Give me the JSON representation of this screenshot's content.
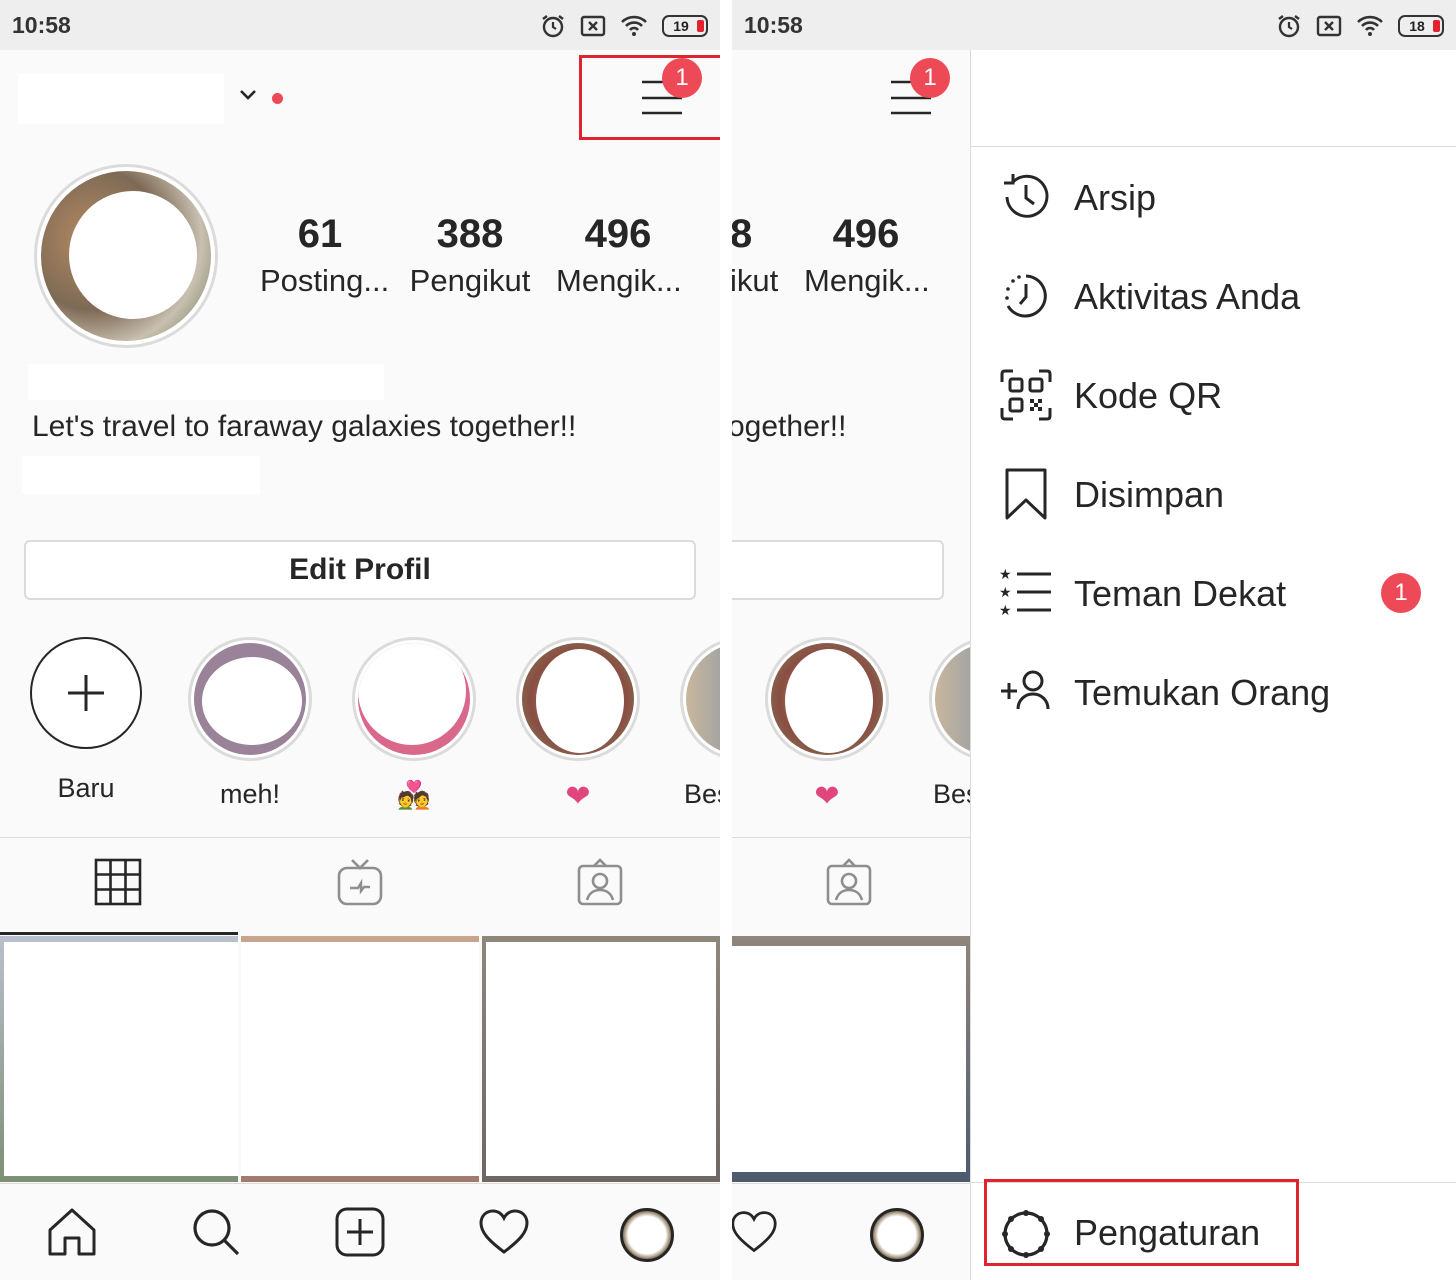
{
  "left_screen": {
    "status": {
      "time": "10:58",
      "battery": "19"
    },
    "header": {
      "menu_badge": "1"
    },
    "stats": [
      {
        "value": "61",
        "label": "Posting..."
      },
      {
        "value": "388",
        "label": "Pengikut"
      },
      {
        "value": "496",
        "label": "Mengik..."
      }
    ],
    "bio": "Let's travel to faraway galaxies together!!",
    "edit_profile_label": "Edit Profil",
    "highlights": [
      {
        "label": "Baru"
      },
      {
        "label": "meh!"
      },
      {
        "label": "💑"
      },
      {
        "label": "❤"
      },
      {
        "label": "Bes"
      }
    ]
  },
  "right_screen": {
    "status": {
      "time": "10:58",
      "battery": "18"
    },
    "header": {
      "menu_badge": "1"
    },
    "stats": [
      {
        "value": "8",
        "label": "ikut"
      },
      {
        "value": "496",
        "label": "Mengik..."
      }
    ],
    "bio": "ogether!!",
    "highlights": [
      {
        "label": "❤"
      },
      {
        "label": "Bes"
      }
    ]
  },
  "drawer": {
    "items": [
      {
        "label": "Arsip",
        "icon": "archive-clock-icon"
      },
      {
        "label": "Aktivitas Anda",
        "icon": "activity-clock-icon"
      },
      {
        "label": "Kode QR",
        "icon": "qr-code-icon"
      },
      {
        "label": "Disimpan",
        "icon": "bookmark-icon"
      },
      {
        "label": "Teman Dekat",
        "icon": "close-friends-list-icon",
        "badge": "1"
      },
      {
        "label": "Temukan Orang",
        "icon": "add-person-icon"
      }
    ],
    "footer": {
      "label": "Pengaturan",
      "icon": "settings-gear-icon"
    }
  },
  "colors": {
    "badge": "#ed4956",
    "highlight_box": "#e0232f",
    "text": "#262626",
    "divider": "#dbdbdb"
  }
}
